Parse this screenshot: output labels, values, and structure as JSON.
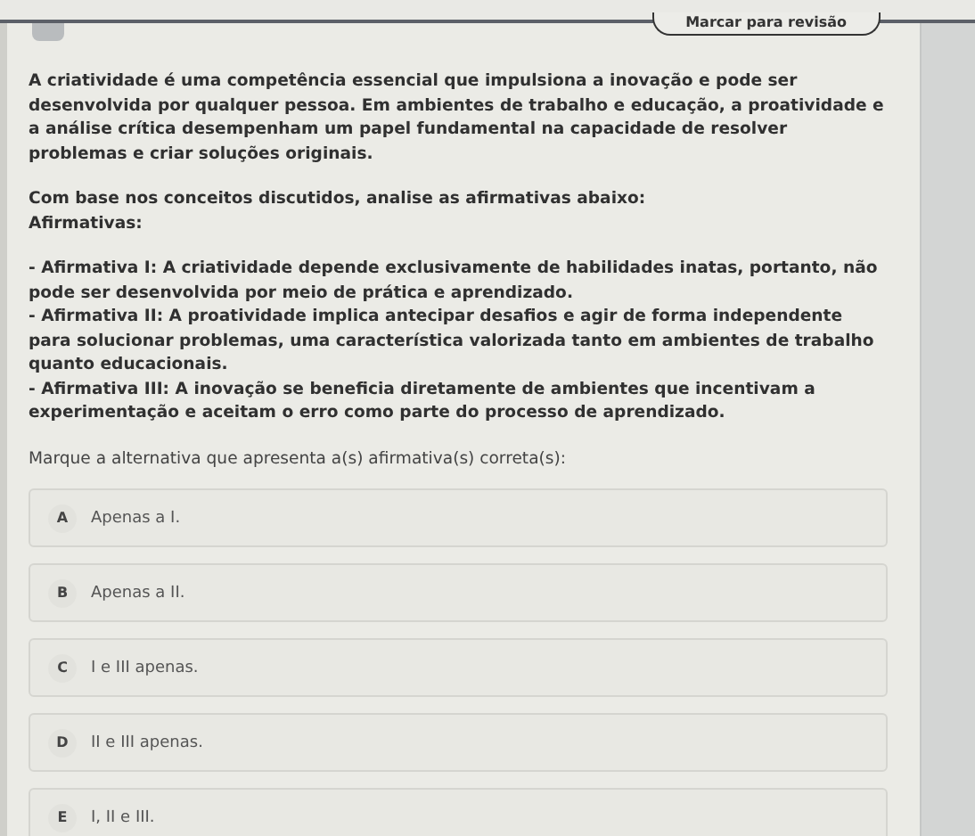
{
  "header": {
    "review_button": "Marcar para revisão"
  },
  "question": {
    "intro": "A criatividade é uma competência essencial que impulsiona a inovação e pode ser desenvolvida por qualquer pessoa. Em ambientes de trabalho e educação, a proatividade e a análise crítica desempenham um papel fundamental na capacidade de resolver problemas e criar soluções originais.",
    "prompt": "Com base nos conceitos discutidos, analise as afirmativas abaixo:",
    "statements_title": "Afirmativas:",
    "statements": [
      "- Afirmativa I: A criatividade depende exclusivamente de habilidades inatas, portanto, não pode ser desenvolvida por meio de prática e aprendizado.",
      "- Afirmativa II: A proatividade implica antecipar desafios e agir de forma independente para solucionar problemas, uma característica valorizada tanto em ambientes de trabalho quanto educacionais.",
      "- Afirmativa III: A inovação se beneficia diretamente de ambientes que incentivam a experimentação e aceitam o erro como parte do processo de aprendizado."
    ],
    "instruction": "Marque a alternativa que apresenta a(s) afirmativa(s) correta(s):"
  },
  "options": [
    {
      "letter": "A",
      "text": "Apenas a I.",
      "selected": false
    },
    {
      "letter": "B",
      "text": "Apenas a II.",
      "selected": false
    },
    {
      "letter": "C",
      "text": "I e III apenas.",
      "selected": false
    },
    {
      "letter": "D",
      "text": "II e III apenas.",
      "selected": false
    },
    {
      "letter": "E",
      "text": "I, II e III.",
      "selected": false
    }
  ]
}
